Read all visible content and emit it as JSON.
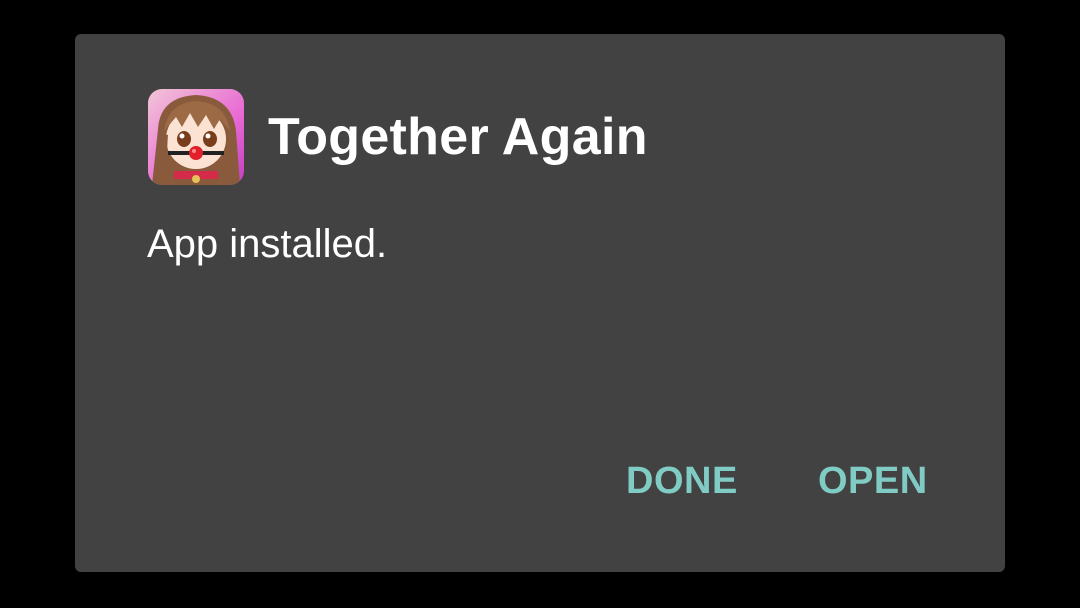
{
  "dialog": {
    "app_name": "Together Again",
    "app_icon": "app-icon-anime-girl",
    "message": "App installed.",
    "buttons": {
      "done_label": "DONE",
      "open_label": "OPEN"
    }
  },
  "colors": {
    "background": "#000000",
    "dialog_background": "#424242",
    "text": "#ffffff",
    "accent": "#80cbc4"
  }
}
